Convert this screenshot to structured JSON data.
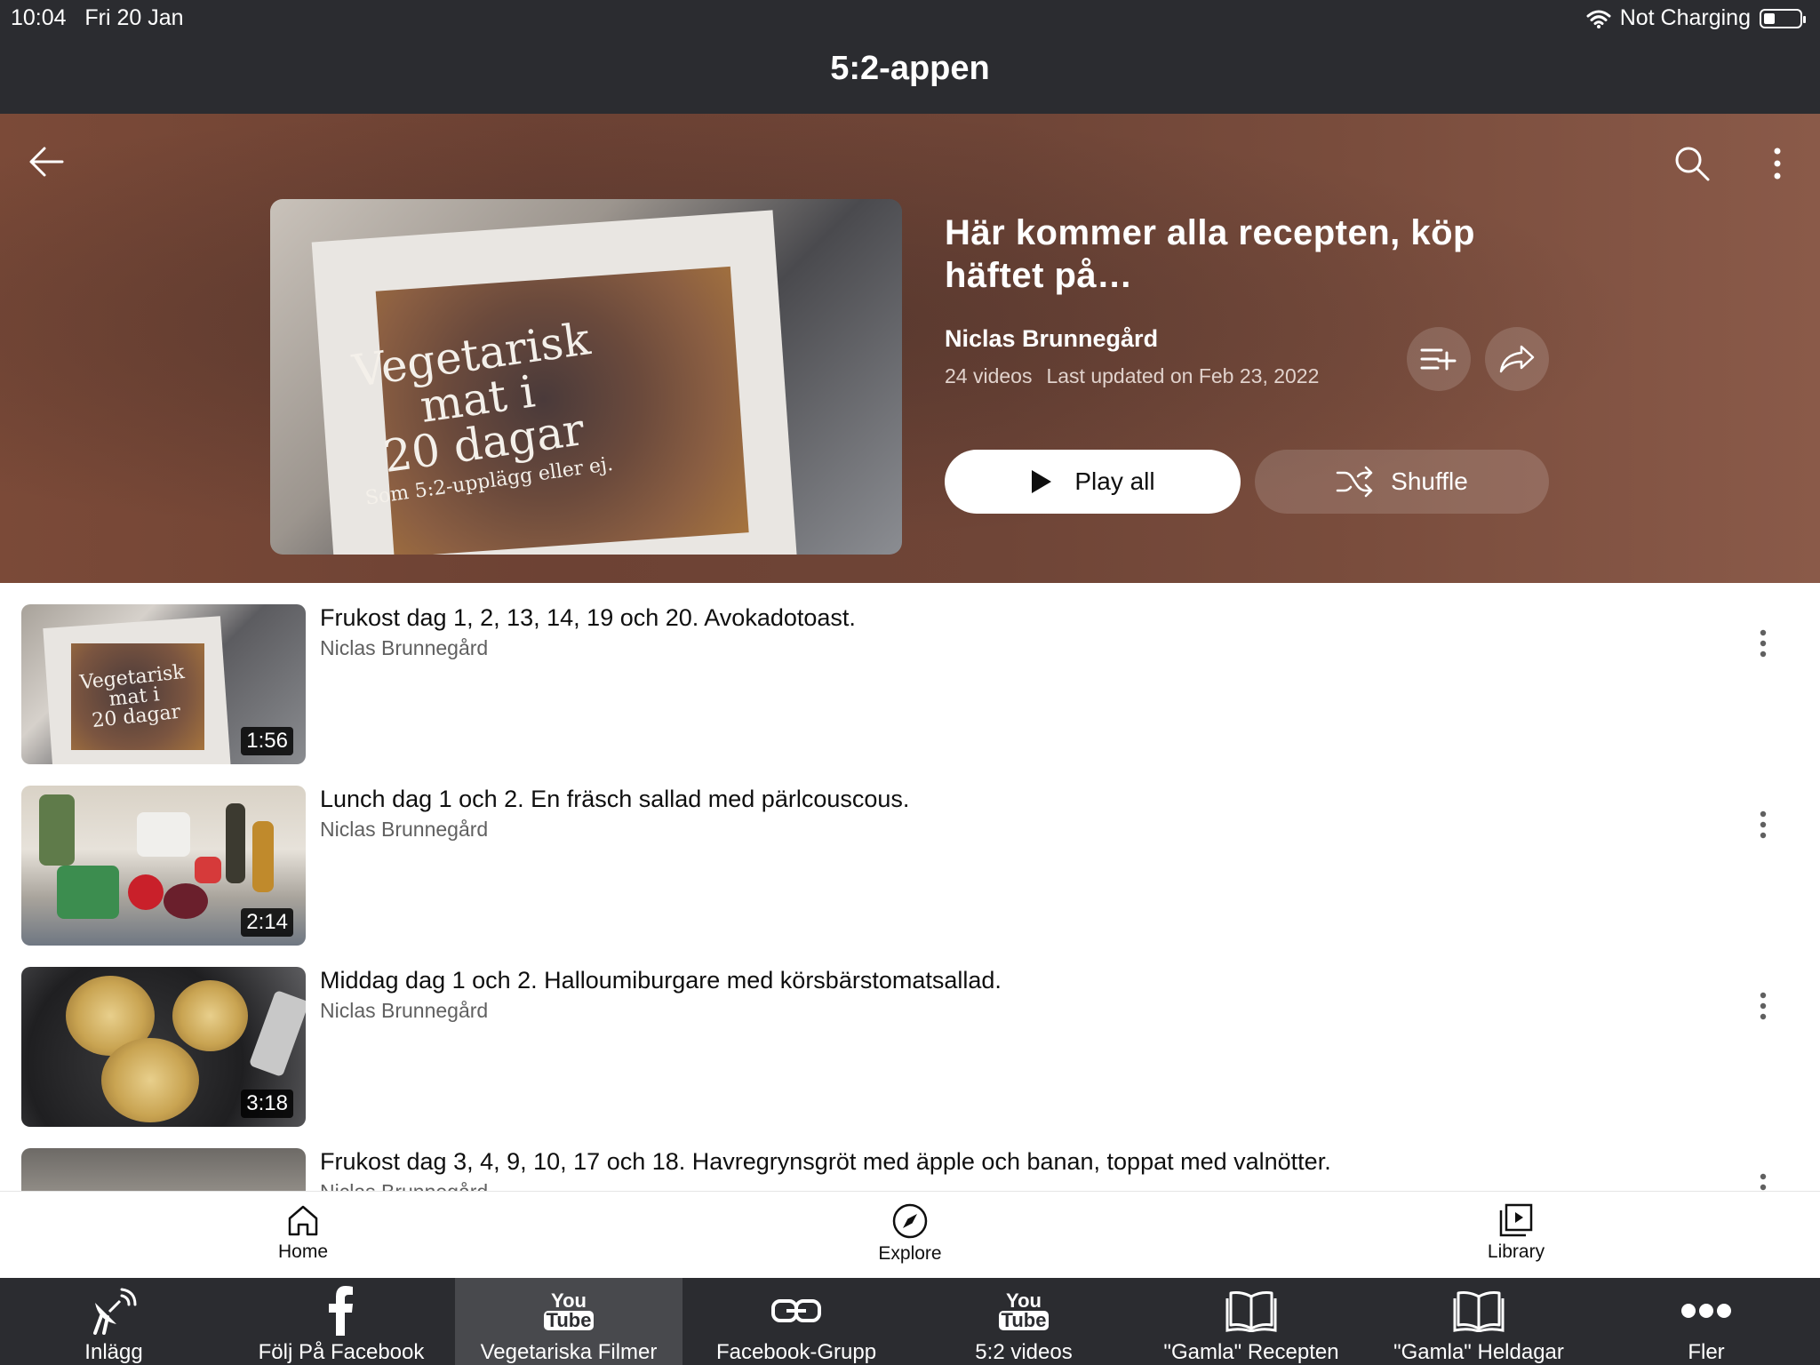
{
  "status": {
    "time": "10:04",
    "date": "Fri 20 Jan",
    "charging": "Not Charging"
  },
  "app": {
    "title": "5:2-appen"
  },
  "header": {
    "icons": {
      "back": "arrow-left-icon",
      "search": "search-icon",
      "more": "more-vert-icon"
    },
    "thumb_text": {
      "line1": "Vegetarisk",
      "line2": "mat i",
      "line3": "20 dagar",
      "line4": "Som 5:2-upplägg eller ej."
    },
    "title": "Här kommer alla recepten, köp häftet på…",
    "author": "Niclas Brunnegård",
    "video_count": "24 videos",
    "last_updated": "Last updated on Feb 23, 2022",
    "play_all": "Play all",
    "shuffle": "Shuffle"
  },
  "videos": [
    {
      "title": "Frukost dag 1, 2, 13, 14, 19 och 20. Avokadotoast.",
      "author": "Niclas Brunnegård",
      "duration": "1:56",
      "thumb_text": {
        "line1": "Vegetarisk",
        "line2": "mat i",
        "line3": "20 dagar"
      }
    },
    {
      "title": "Lunch dag 1 och 2. En fräsch sallad med pärlcouscous.",
      "author": "Niclas Brunnegård",
      "duration": "2:14"
    },
    {
      "title": "Middag dag 1 och 2. Halloumiburgare med körsbärstomatsallad.",
      "author": "Niclas Brunnegård",
      "duration": "3:18"
    },
    {
      "title": "Frukost dag 3, 4, 9, 10, 17 och 18. Havregrynsgröt med äpple och banan, toppat med valnötter.",
      "author": "Niclas Brunnegård"
    }
  ],
  "bottom_nav": [
    {
      "label": "Home",
      "icon": "home-icon"
    },
    {
      "label": "Explore",
      "icon": "compass-icon"
    },
    {
      "label": "Library",
      "icon": "library-icon"
    }
  ],
  "tabs": [
    {
      "label": "Inlägg",
      "icon": "satellite-dish-icon"
    },
    {
      "label": "Följ På Facebook",
      "icon": "facebook-icon"
    },
    {
      "label": "Vegetariska Filmer",
      "icon": "youtube-icon",
      "active": true
    },
    {
      "label": "Facebook-Grupp",
      "icon": "link-icon"
    },
    {
      "label": "5:2 videos",
      "icon": "youtube-icon"
    },
    {
      "label": "\"Gamla\" Recepten",
      "icon": "book-icon"
    },
    {
      "label": "\"Gamla\" Heldagar",
      "icon": "book-icon"
    },
    {
      "label": "Fler",
      "icon": "more-horiz-icon"
    }
  ],
  "colors": {
    "header_bg": "#6f4537",
    "topbar_bg": "#2b2c30",
    "tab_active_bg": "#48494d"
  }
}
